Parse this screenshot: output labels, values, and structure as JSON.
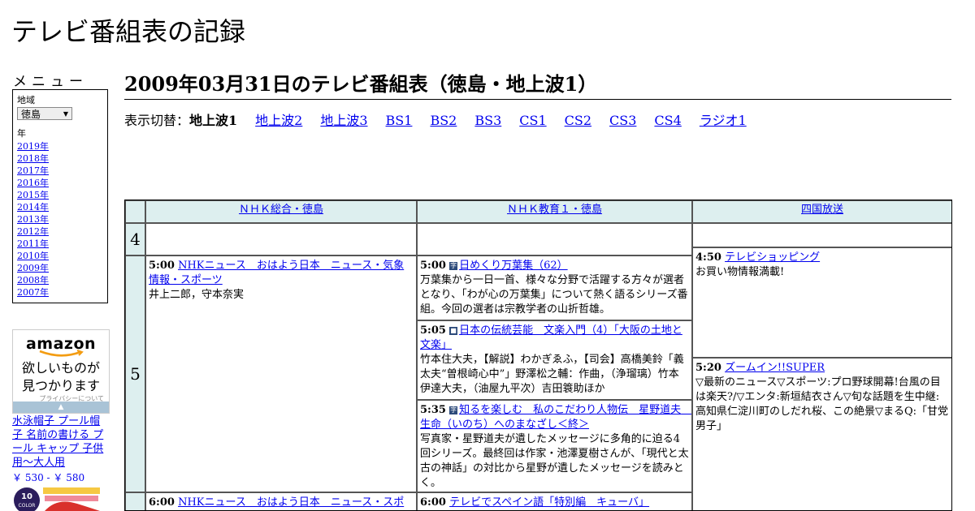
{
  "site_title": "テレビ番組表の記録",
  "menu": {
    "heading": "メニュー",
    "region_label": "地域",
    "region_value": "徳島",
    "year_label": "年",
    "years": [
      "2019年",
      "2018年",
      "2017年",
      "2016年",
      "2015年",
      "2014年",
      "2013年",
      "2012年",
      "2011年",
      "2010年",
      "2009年",
      "2008年",
      "2007年"
    ]
  },
  "ad": {
    "logo": "amazon",
    "line1": "欲しいものが",
    "line2": "見つかります",
    "privacy": "プライバシーについて",
    "product_title": "水泳帽子 プール帽子 名前の書ける プール キャップ 子供用～大人用",
    "product_price": "￥ 530 - ￥ 580",
    "product_badge": "10",
    "product_badge_sub": "COLOR"
  },
  "page_heading": "2009年03月31日のテレビ番組表（徳島・地上波1）",
  "channel_switch": {
    "label": "表示切替：",
    "current": "地上波1",
    "links": [
      "地上波2",
      "地上波3",
      "BS1",
      "BS2",
      "BS3",
      "CS1",
      "CS2",
      "CS3",
      "CS4",
      "ラジオ1"
    ]
  },
  "schedule": {
    "stations": [
      "ＮＨＫ総合・徳島",
      "ＮＨＫ教育１・徳島",
      "四国放送"
    ],
    "hours": [
      "4",
      "5"
    ],
    "programs": {
      "nhk1_0500": {
        "time": "5:00",
        "title": "NHKニュース　おはよう日本　ニュース・気象情報・スポーツ",
        "desc": "井上二郎，守本奈実"
      },
      "nhk1_0600": {
        "time": "6:00",
        "title": "NHKニュース　おはよう日本　ニュース・スポーツ",
        "desc": ""
      },
      "etv_0500": {
        "time": "5:00",
        "icon": "字",
        "title": "日めくり万葉集（62）",
        "desc": "万葉集から一日一首、様々な分野で活躍する方々が選者となり、「わが心の万葉集」について熱く語るシリーズ番組。今回の選者は宗教学者の山折哲雄。"
      },
      "etv_0505": {
        "time": "5:05",
        "icon": "■",
        "title": "日本の伝統芸能　文楽入門（4）「大阪の土地と文楽」",
        "desc": "竹本住大夫，【解説】わかぎゑふ，【司会】高橋美鈴「義太夫“曽根崎心中”」野澤松之輔：作曲，（浄瑠璃）竹本伊達大夫，（油屋九平次）吉田簑助ほか"
      },
      "etv_0535": {
        "time": "5:35",
        "icon": "字",
        "title": "知るを楽しむ　私のこだわり人物伝　星野道夫　生命（いのち）へのまなざし＜終＞",
        "desc": "写真家・星野道夫が遺したメッセージに多角的に迫る4回シリーズ。最終回は作家・池澤夏樹さんが、「現代と太古の神話」の対比から星野が遺したメッセージを読みとく。"
      },
      "etv_0600": {
        "time": "6:00",
        "title": "テレビでスペイン語「特別編　キューバ」",
        "desc": ""
      },
      "jrt_0450": {
        "time": "4:50",
        "title": "テレビショッピング",
        "desc": "お買い物情報満載!"
      },
      "jrt_0520": {
        "time": "5:20",
        "title": "ズームイン!!SUPER",
        "desc": "▽最新のニュース▽スポーツ:プロ野球開幕!台風の目は楽天?/▽エンタ:新垣結衣さん▽旬な話題を生中継:高知県仁淀川町のしだれ桜、この絶景▽まるQ:「甘党男子」"
      }
    }
  }
}
